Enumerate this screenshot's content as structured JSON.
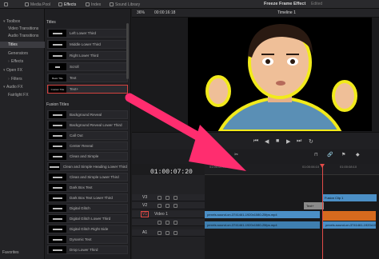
{
  "topbar": {
    "media_pool": "Media Pool",
    "effects": "Effects",
    "index": "Index",
    "sound_library": "Sound Library",
    "project_title": "Freeze Frame Effect",
    "edited": "Edited"
  },
  "toolbox": {
    "items": [
      {
        "label": "Toolbox",
        "expanded": true
      },
      {
        "label": "Video Transitions"
      },
      {
        "label": "Audio Transitions"
      },
      {
        "label": "Titles"
      },
      {
        "label": "Generators"
      },
      {
        "label": "Effects"
      },
      {
        "label": "Open FX"
      },
      {
        "label": "Filters"
      },
      {
        "label": "Audio FX"
      },
      {
        "label": "Fairlight FX"
      }
    ],
    "favorites": "Favorites"
  },
  "titles": {
    "header": "Titles",
    "items": [
      "Left Lower Third",
      "Middle Lower Third",
      "Right Lower Third",
      "Scroll",
      "Text",
      "Text+"
    ],
    "thumb_text_1": "Basic Title",
    "thumb_text_2": "Custom Title",
    "fusion_header": "Fusion Titles",
    "fusion_items": [
      "Background Reveal",
      "Background Reveal Lower Third",
      "Call Out",
      "Center Reveal",
      "Clean and Simple",
      "Clean and Simple Heading Lower Third",
      "Clean and Simple Lower Third",
      "Dark Box Text",
      "Dark Box Text Lower Third",
      "Digital Glitch",
      "Digital Glitch Lower Third",
      "Digital Glitch Right Side",
      "Dynamic Text",
      "Drop Lower Third"
    ]
  },
  "viewer": {
    "zoom": "36%",
    "timecode": "00:00:16:18",
    "timeline_name": "Timeline 1"
  },
  "timeline": {
    "timecode": "01:00:07:20",
    "ruler_labels": [
      "01:00:00:00",
      "01:00:06:10",
      "01:00:08:10"
    ],
    "tracks": [
      {
        "name": "V3"
      },
      {
        "name": "V2"
      },
      {
        "name": "V1",
        "label": "Video 1"
      },
      {
        "name": "A1"
      }
    ],
    "clips": {
      "fusion": "Fusion Clip 1",
      "text": "Text+",
      "video": "pexels-sound-on-3741461-1920x1080-25fps.mp4",
      "audio": "pexels-sound-on-3741461-1920x1080-25fps.mp4",
      "audio_right": "pexels-sound-on-3741461-1920x1080-25fps.mp4"
    }
  },
  "colors": {
    "accent": "#e34b48",
    "clip_blue": "#4b8fc6",
    "fusion_clip": "#4b8fc6",
    "arrow": "#ff2d6f",
    "outline_yellow": "#f2ea1b"
  }
}
